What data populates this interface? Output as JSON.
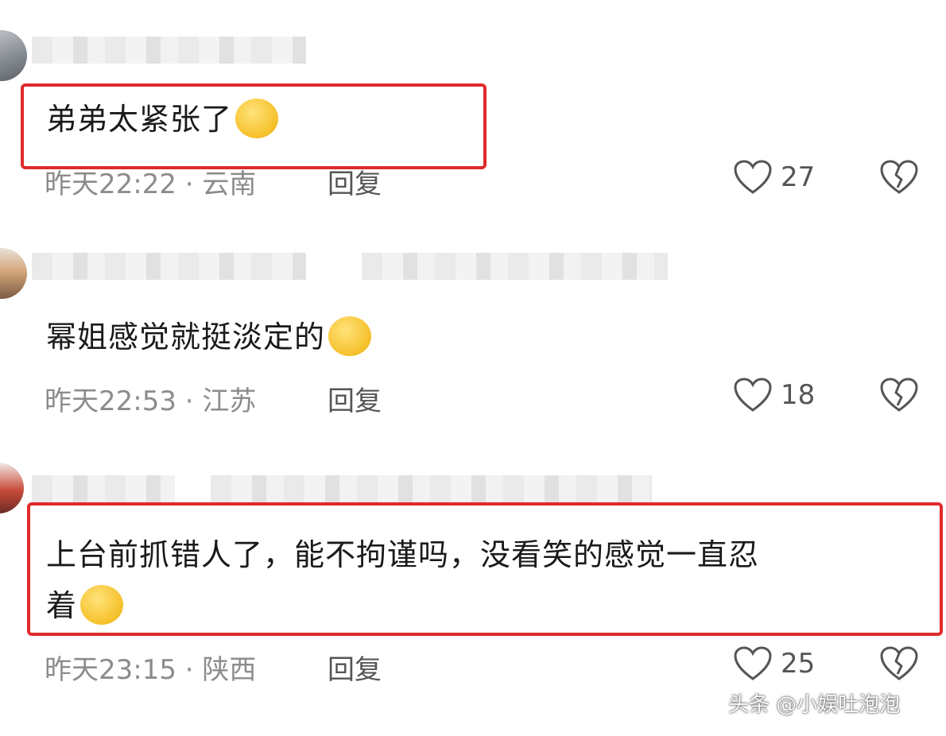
{
  "comments": [
    {
      "text": "弟弟太紧张了",
      "emoji": "crying-laughing-emoji",
      "time": "昨天22:22",
      "location": "云南",
      "reply_label": "回复",
      "likes": "27",
      "highlighted": true
    },
    {
      "text": "幂姐感觉就挺淡定的",
      "emoji": "grinning-emoji",
      "time": "昨天22:53",
      "location": "江苏",
      "reply_label": "回复",
      "likes": "18",
      "highlighted": false
    },
    {
      "text_line1": "上台前抓错人了，能不拘谨吗，没看笑的感觉一直忍",
      "text_line2": "着",
      "emoji": "crying-laughing-emoji",
      "time": "昨天23:15",
      "location": "陕西",
      "reply_label": "回复",
      "likes": "25",
      "highlighted": true
    }
  ],
  "separator": "·",
  "watermark": "头条 @小娱吐泡泡",
  "colors": {
    "highlight_border": "#e02a2a",
    "meta_text": "#8c8c8c",
    "icon_stroke": "#555555"
  }
}
